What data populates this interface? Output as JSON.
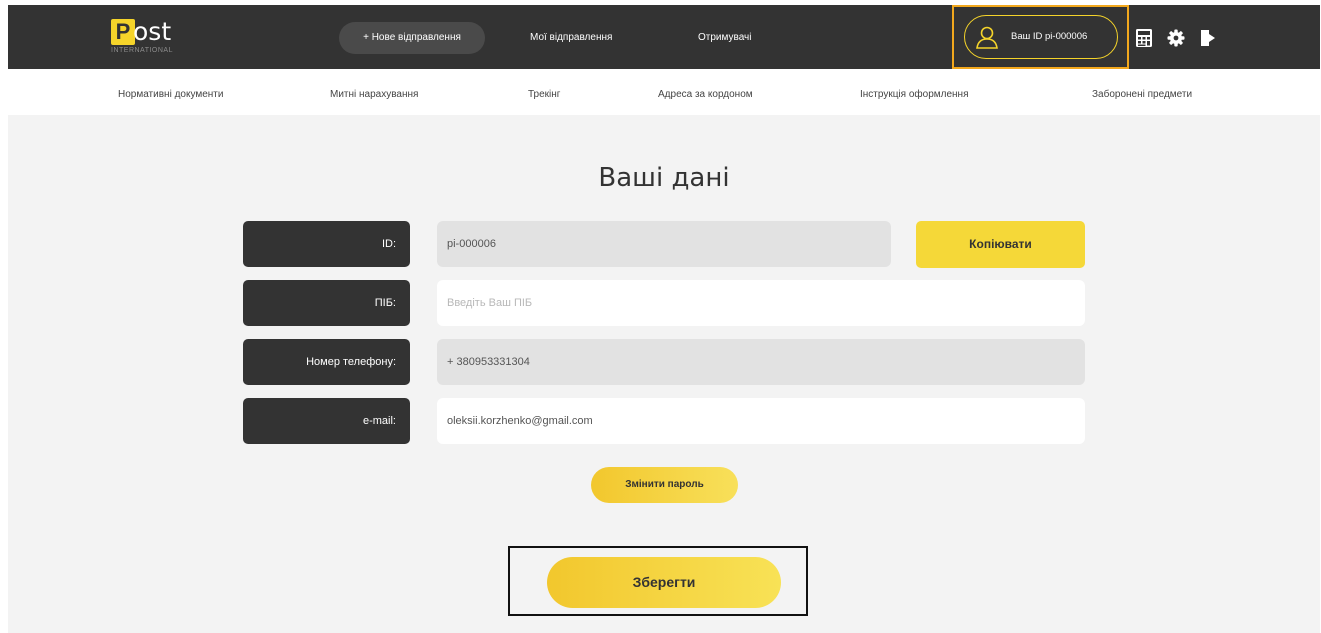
{
  "brand": {
    "logo_letter": "P",
    "logo_text": "ost",
    "logo_subtitle": "INTERNATIONAL",
    "accent_color": "#f5d42a",
    "dark_color": "#333333"
  },
  "topnav": {
    "new_shipment": "+ Нове відправлення",
    "my_shipments": "Мої відправлення",
    "recipients": "Отримувачі",
    "user_id_label": "Ваш ID pi-000006",
    "icons": [
      "user-icon",
      "calculator-icon",
      "gear-icon",
      "logout-icon"
    ]
  },
  "subnav": {
    "items": [
      "Нормативні документи",
      "Митні нарахування",
      "Трекінг",
      "Адреса за кордоном",
      "Інструкція оформлення",
      "Заборонені предмети"
    ]
  },
  "main": {
    "title": "Ваші дані",
    "fields": [
      {
        "label": "ID:",
        "value": "pi-000006",
        "placeholder": ""
      },
      {
        "label": "ПІБ:",
        "value": "",
        "placeholder": "Введіть Ваш ПІБ"
      },
      {
        "label": "Номер телефону:",
        "value": "+ 380953331304",
        "placeholder": ""
      },
      {
        "label": "e-mail:",
        "value": "oleksii.korzhenko@gmail.com",
        "placeholder": ""
      }
    ],
    "copy_button": "Копіювати",
    "change_password_button": "Змінити пароль",
    "save_button": "Зберегти"
  }
}
